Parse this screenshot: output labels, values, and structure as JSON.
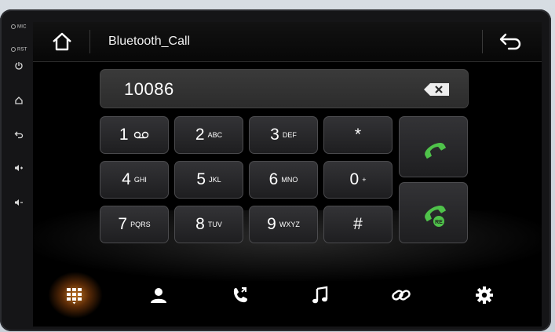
{
  "side": {
    "mic_label": "MIC",
    "rst_label": "RST"
  },
  "header": {
    "title": "Bluetooth_Call"
  },
  "dialer": {
    "number": "10086"
  },
  "keypad": [
    {
      "digit": "1",
      "letters": "voicemail"
    },
    {
      "digit": "2",
      "letters": "ABC"
    },
    {
      "digit": "3",
      "letters": "DEF"
    },
    {
      "digit": "*",
      "letters": ""
    },
    {
      "digit": "4",
      "letters": "GHI"
    },
    {
      "digit": "5",
      "letters": "JKL"
    },
    {
      "digit": "6",
      "letters": "MNO"
    },
    {
      "digit": "0",
      "letters": "+"
    },
    {
      "digit": "7",
      "letters": "PQRS"
    },
    {
      "digit": "8",
      "letters": "TUV"
    },
    {
      "digit": "9",
      "letters": "WXYZ"
    },
    {
      "digit": "#",
      "letters": ""
    }
  ],
  "call_buttons": [
    "call-icon",
    "redial-icon"
  ],
  "bottom_nav": [
    "dialpad-icon",
    "contacts-icon",
    "call-log-icon",
    "music-icon",
    "link-icon",
    "settings-icon"
  ],
  "colors": {
    "accent_green": "#4fc24a",
    "active_glow": "#ff9628",
    "background": "#000000"
  }
}
